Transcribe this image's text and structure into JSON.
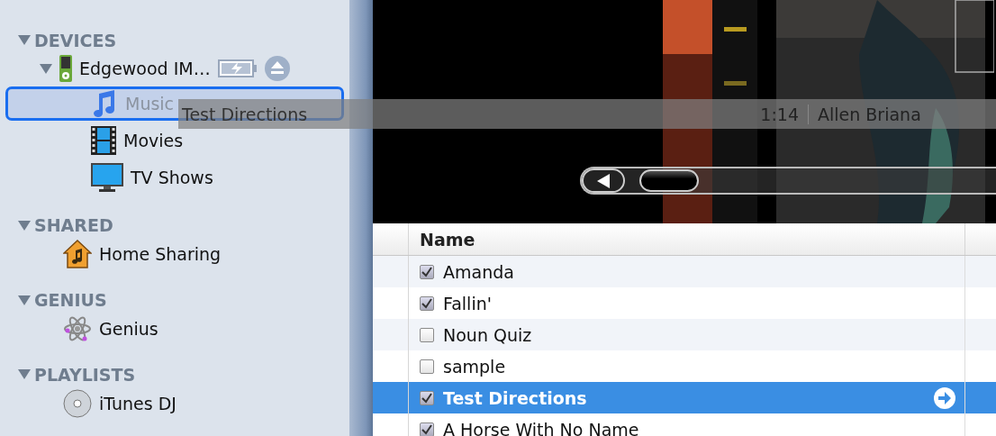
{
  "sidebar": {
    "sections": [
      {
        "title": "DEVICES",
        "expanded": true,
        "items": [
          {
            "kind": "device",
            "label": "Edgewood IM…",
            "expanded": true,
            "children": [
              {
                "kind": "music",
                "label": "Music",
                "drop_target": true
              },
              {
                "kind": "movies",
                "label": "Movies",
                "drop_target": false
              },
              {
                "kind": "tv",
                "label": "TV Shows",
                "drop_target": false
              }
            ]
          }
        ]
      },
      {
        "title": "SHARED",
        "expanded": true,
        "items": [
          {
            "kind": "home",
            "label": "Home Sharing"
          }
        ]
      },
      {
        "title": "GENIUS",
        "expanded": true,
        "items": [
          {
            "kind": "genius",
            "label": "Genius"
          }
        ]
      },
      {
        "title": "PLAYLISTS",
        "expanded": true,
        "items": [
          {
            "kind": "dj",
            "label": "iTunes DJ"
          }
        ]
      }
    ]
  },
  "drag_ghost": {
    "title": "Test Directions",
    "time": "1:14",
    "artist": "Allen Briana"
  },
  "track_list": {
    "columns": [
      "Name"
    ],
    "rows": [
      {
        "name": "Amanda",
        "checked": true,
        "selected": false
      },
      {
        "name": "Fallin'",
        "checked": true,
        "selected": false
      },
      {
        "name": "Noun Quiz",
        "checked": false,
        "selected": false
      },
      {
        "name": "sample",
        "checked": false,
        "selected": false
      },
      {
        "name": "Test Directions",
        "checked": true,
        "selected": true
      },
      {
        "name": "A Horse With No Name",
        "checked": true,
        "selected": false
      }
    ]
  }
}
